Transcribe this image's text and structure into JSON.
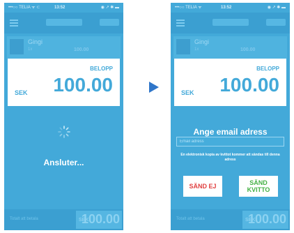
{
  "left_screen": {
    "statusbar": {
      "carrier": "•••○○ TELIA ᯤ ⊂",
      "time": "13:52",
      "icons": "◉ ↗ ✱ ▬"
    },
    "order": {
      "name": "Gingi",
      "sub": "1x",
      "price": "100.00"
    },
    "amount_card": {
      "label": "BELOPP",
      "currency": "SEK",
      "amount": "100.00"
    },
    "status_text": "Ansluter...",
    "bottom": {
      "left_text": "Totalt att betala",
      "currency": "SEK",
      "amount": "100.00"
    }
  },
  "right_screen": {
    "statusbar": {
      "carrier": "•••○○ TELIA ᯤ",
      "time": "13:52",
      "icons": "◉ ↗ ✱ ▬"
    },
    "order": {
      "name": "Gingi",
      "sub": "1x",
      "price": "100.00"
    },
    "amount_card": {
      "label": "BELOPP",
      "currency": "SEK",
      "amount": "100.00"
    },
    "email_heading": "Ange email adress",
    "email_placeholder": "Email adress",
    "receipt_info": "En elektronisk kopia av kvittot kommer att sändas till denna adress",
    "buttons": {
      "no": "SÄND EJ",
      "send_line1": "SÄND",
      "send_line2": "KVITTO"
    },
    "bottom": {
      "left_text": "Totalt att betala",
      "currency": "SEK",
      "amount": "100.00"
    }
  },
  "colors": {
    "app_blue": "#43a9d9",
    "no_red": "#e04040",
    "send_green": "#44b044",
    "arrow": "#2f76c9"
  },
  "icons": [
    "menu-icon",
    "spinner-icon",
    "arrow-right-icon"
  ]
}
